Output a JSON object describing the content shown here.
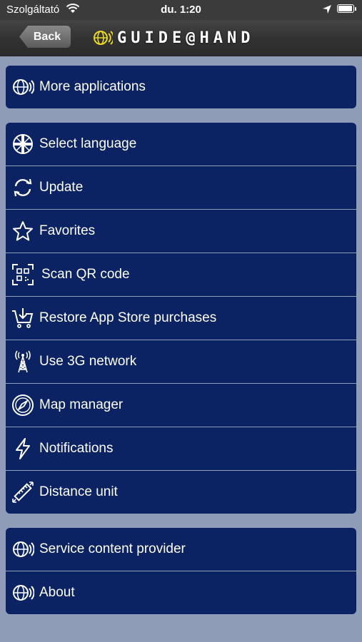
{
  "status_bar": {
    "carrier": "Szolgáltató",
    "time": "du. 1:20"
  },
  "nav": {
    "back_label": "Back",
    "logo_text": "GUIDE@HAND"
  },
  "groups": [
    {
      "items": [
        {
          "label": "More applications",
          "icon": "globe-signal-icon"
        }
      ]
    },
    {
      "items": [
        {
          "label": "Select language",
          "icon": "flag-icon"
        },
        {
          "label": "Update",
          "icon": "refresh-icon"
        },
        {
          "label": "Favorites",
          "icon": "star-icon"
        },
        {
          "label": "Scan QR code",
          "icon": "qr-code-icon"
        },
        {
          "label": "Restore App Store purchases",
          "icon": "cart-download-icon"
        },
        {
          "label": "Use 3G network",
          "icon": "antenna-icon"
        },
        {
          "label": "Map manager",
          "icon": "compass-icon"
        },
        {
          "label": "Notifications",
          "icon": "lightning-icon"
        },
        {
          "label": "Distance unit",
          "icon": "ruler-icon"
        }
      ]
    },
    {
      "items": [
        {
          "label": "Service content provider",
          "icon": "globe-signal-icon"
        },
        {
          "label": "About",
          "icon": "globe-signal-icon"
        }
      ]
    }
  ]
}
